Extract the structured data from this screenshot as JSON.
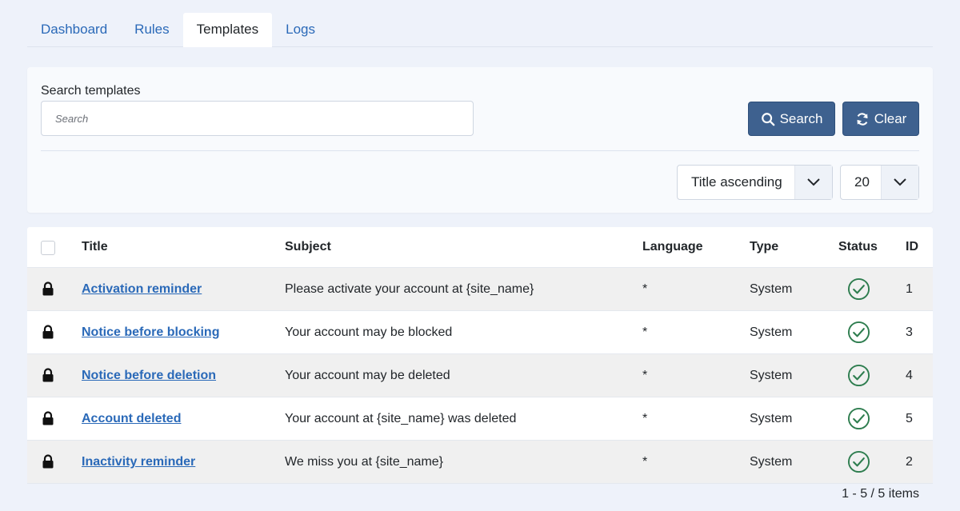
{
  "tabs": [
    {
      "label": "Dashboard",
      "active": false
    },
    {
      "label": "Rules",
      "active": false
    },
    {
      "label": "Templates",
      "active": true
    },
    {
      "label": "Logs",
      "active": false
    }
  ],
  "filter": {
    "search_label": "Search templates",
    "search_placeholder": "Search",
    "search_value": "",
    "search_button": "Search",
    "clear_button": "Clear",
    "ordering": "Title ascending",
    "limit": "20"
  },
  "table": {
    "headers": {
      "title": "Title",
      "subject": "Subject",
      "language": "Language",
      "type": "Type",
      "status": "Status",
      "id": "ID"
    },
    "rows": [
      {
        "title": "Activation reminder",
        "subject": "Please activate your account at {site_name}",
        "language": "*",
        "type": "System",
        "status": "published",
        "id": "1"
      },
      {
        "title": "Notice before blocking",
        "subject": "Your account may be blocked",
        "language": "*",
        "type": "System",
        "status": "published",
        "id": "3"
      },
      {
        "title": "Notice before deletion",
        "subject": "Your account may be deleted",
        "language": "*",
        "type": "System",
        "status": "published",
        "id": "4"
      },
      {
        "title": "Account deleted",
        "subject": "Your account at {site_name} was deleted",
        "language": "*",
        "type": "System",
        "status": "published",
        "id": "5"
      },
      {
        "title": "Inactivity reminder",
        "subject": "We miss you at {site_name}",
        "language": "*",
        "type": "System",
        "status": "published",
        "id": "2"
      }
    ]
  },
  "pagination": {
    "summary": "1 - 5 / 5 items"
  },
  "colors": {
    "accent": "#3e618f",
    "link": "#2a69b8",
    "status_ok": "#2e7d4f",
    "background": "#eef2fa"
  },
  "icons": {
    "search_button": "search-icon",
    "clear_button": "refresh-icon",
    "row_lock": "lock-icon",
    "status": "check-circle-icon",
    "select_caret": "chevron-down-icon"
  }
}
